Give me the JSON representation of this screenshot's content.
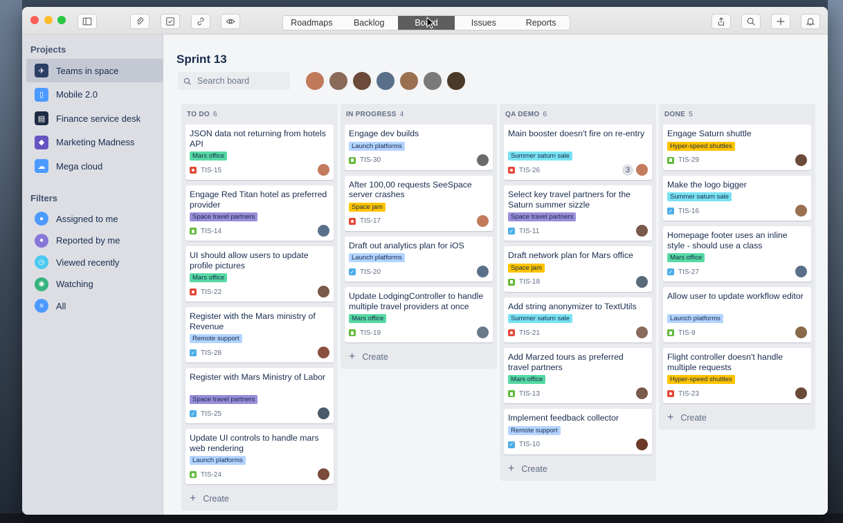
{
  "colors": {
    "tag_green": "#57d9a3",
    "tag_purple": "#998dd9",
    "tag_blue": "#b3d4ff",
    "tag_cyan": "#79e2f2",
    "tag_yellow": "#ffc400",
    "active_segment": "#5e5e5e"
  },
  "toolbar": {
    "icons": [
      "sidebar-toggle-icon",
      "paperclip-icon",
      "checklist-icon",
      "link-icon",
      "eye-icon"
    ],
    "tabs": [
      {
        "label": "Roadmaps",
        "active": false
      },
      {
        "label": "Backlog",
        "active": false
      },
      {
        "label": "Board",
        "active": true
      },
      {
        "label": "Issues",
        "active": false
      },
      {
        "label": "Reports",
        "active": false
      }
    ],
    "right_icons": [
      "share-icon",
      "search-icon",
      "plus-icon",
      "bell-icon"
    ]
  },
  "sidebar": {
    "projects_heading": "Projects",
    "projects": [
      {
        "label": "Teams in space",
        "active": true,
        "icon": "rocket-icon",
        "color": "#2a3f63"
      },
      {
        "label": "Mobile 2.0",
        "active": false,
        "icon": "mobile-icon",
        "color": "#4c9aff"
      },
      {
        "label": "Finance service desk",
        "active": false,
        "icon": "finance-icon",
        "color": "#1f2a44"
      },
      {
        "label": "Marketing Madness",
        "active": false,
        "icon": "marketing-icon",
        "color": "#6554c0"
      },
      {
        "label": "Mega cloud",
        "active": false,
        "icon": "cloud-icon",
        "color": "#4c9aff"
      }
    ],
    "filters_heading": "Filters",
    "filters": [
      {
        "label": "Assigned to me",
        "icon": "user-icon",
        "color": "#4c9aff"
      },
      {
        "label": "Reported by me",
        "icon": "user-icon",
        "color": "#8777d9"
      },
      {
        "label": "Viewed recently",
        "icon": "clock-icon",
        "color": "#4cc9f0"
      },
      {
        "label": "Watching",
        "icon": "eye-icon",
        "color": "#36b37e"
      },
      {
        "label": "All",
        "icon": "list-icon",
        "color": "#4c9aff"
      }
    ]
  },
  "board": {
    "title": "Sprint 13",
    "search_placeholder": "Search board",
    "create_label": "Create",
    "avatars": [
      "#c07a5a",
      "#8a6a5a",
      "#6b4a3a",
      "#5a6f8a",
      "#9a7050",
      "#7a7a7a",
      "#4a3a2a"
    ],
    "columns": [
      {
        "name": "TO DO",
        "count": "6",
        "cards": [
          {
            "title": "JSON data not returning from hotels API",
            "tag": "Mars office",
            "tag_color": "#57d9a3",
            "type": "bug",
            "key": "TIS-15",
            "avatar": "#c27b5c"
          },
          {
            "title": "Engage Red Titan hotel as preferred provider",
            "tag": "Space travel partners",
            "tag_color": "#998dd9",
            "type": "story",
            "key": "TIS-14",
            "avatar": "#5a6f8a"
          },
          {
            "title": "UI should allow users to update profile pictures",
            "tag": "Mars office",
            "tag_color": "#57d9a3",
            "type": "bug",
            "key": "TIS-22",
            "avatar": "#7a5a4a"
          },
          {
            "title": "Register with the Mars ministry of Revenue",
            "tag": "Remote support",
            "tag_color": "#b3d4ff",
            "type": "task",
            "key": "TIS-28",
            "avatar": "#8a5040"
          },
          {
            "title": "Register with Mars Ministry of Labor",
            "tag": "Space travel partners",
            "tag_color": "#998dd9",
            "type": "task",
            "key": "TIS-25",
            "avatar": "#4a5a6a"
          },
          {
            "title": "Update UI controls to handle mars web rendering",
            "tag": "Launch platforms",
            "tag_color": "#b3d4ff",
            "type": "story",
            "key": "TIS-24",
            "avatar": "#7a4a3a"
          }
        ]
      },
      {
        "name": "IN PROGRESS",
        "count": "4",
        "cards": [
          {
            "title": "Engage dev builds",
            "tag": "Launch platforms",
            "tag_color": "#b3d4ff",
            "type": "story",
            "key": "TIS-30",
            "avatar": "#6a6a6a"
          },
          {
            "title": "After 100,00 requests SeeSpace server crashes",
            "tag": "Space jam",
            "tag_color": "#ffc400",
            "type": "bug",
            "key": "TIS-17",
            "avatar": "#c27b5c"
          },
          {
            "title": "Draft out analytics plan for iOS",
            "tag": "Launch platforms",
            "tag_color": "#b3d4ff",
            "type": "task",
            "key": "TIS-20",
            "avatar": "#5a6f8a"
          },
          {
            "title": "Update LodgingController to handle multiple travel providers at once",
            "tag": "Mars office",
            "tag_color": "#57d9a3",
            "type": "story",
            "key": "TIS-19",
            "avatar": "#6a7a8a"
          }
        ]
      },
      {
        "name": "QA DEMO",
        "count": "6",
        "cards": [
          {
            "title": "Main booster doesn't fire on re-entry",
            "tag": "Summer saturn sale",
            "tag_color": "#79e2f2",
            "type": "bug",
            "key": "TIS-26",
            "avatar": "#c27b5c",
            "estimate": "3"
          },
          {
            "title": "Select key travel partners for the Saturn summer sizzle",
            "tag": "Space travel partners",
            "tag_color": "#998dd9",
            "type": "task",
            "key": "TIS-11",
            "avatar": "#7a5a4a"
          },
          {
            "title": "Draft network plan for Mars office",
            "tag": "Space jam",
            "tag_color": "#ffc400",
            "type": "story",
            "key": "TIS-18",
            "avatar": "#5a6a7a"
          },
          {
            "title": "Add string anonymizer to TextUtils",
            "tag": "Summer saturn sale",
            "tag_color": "#79e2f2",
            "type": "bug",
            "key": "TIS-21",
            "avatar": "#8a6a5a"
          },
          {
            "title": "Add Marzed tours as preferred travel partners",
            "tag": "Mars office",
            "tag_color": "#57d9a3",
            "type": "story",
            "key": "TIS-13",
            "avatar": "#7a5a4a"
          },
          {
            "title": "Implement feedback collector",
            "tag": "Remote support",
            "tag_color": "#b3d4ff",
            "type": "task",
            "key": "TIS-10",
            "avatar": "#6b3a2a"
          }
        ]
      },
      {
        "name": "DONE",
        "count": "5",
        "cards": [
          {
            "title": "Engage Saturn shuttle",
            "tag": "Hyper-speed shuttles",
            "tag_color": "#ffc400",
            "type": "story",
            "key": "TIS-29",
            "avatar": "#6b4a3a"
          },
          {
            "title": "Make the logo bigger",
            "tag": "Summer saturn sale",
            "tag_color": "#79e2f2",
            "type": "task",
            "key": "TIS-16",
            "avatar": "#9a7050"
          },
          {
            "title": "Homepage footer uses an inline style - should use a class",
            "tag": "Mars office",
            "tag_color": "#57d9a3",
            "type": "task",
            "key": "TIS-27",
            "avatar": "#5a6f8a"
          },
          {
            "title": "Allow user to update workflow editor",
            "tag": "Launch platforms",
            "tag_color": "#b3d4ff",
            "type": "story",
            "key": "TIS-9",
            "avatar": "#8a6a4a"
          },
          {
            "title": "Flight controller doesn't handle multiple requests",
            "tag": "Hyper-speed shuttles",
            "tag_color": "#ffc400",
            "type": "bug",
            "key": "TIS-23",
            "avatar": "#6b4a3a"
          }
        ]
      }
    ]
  }
}
